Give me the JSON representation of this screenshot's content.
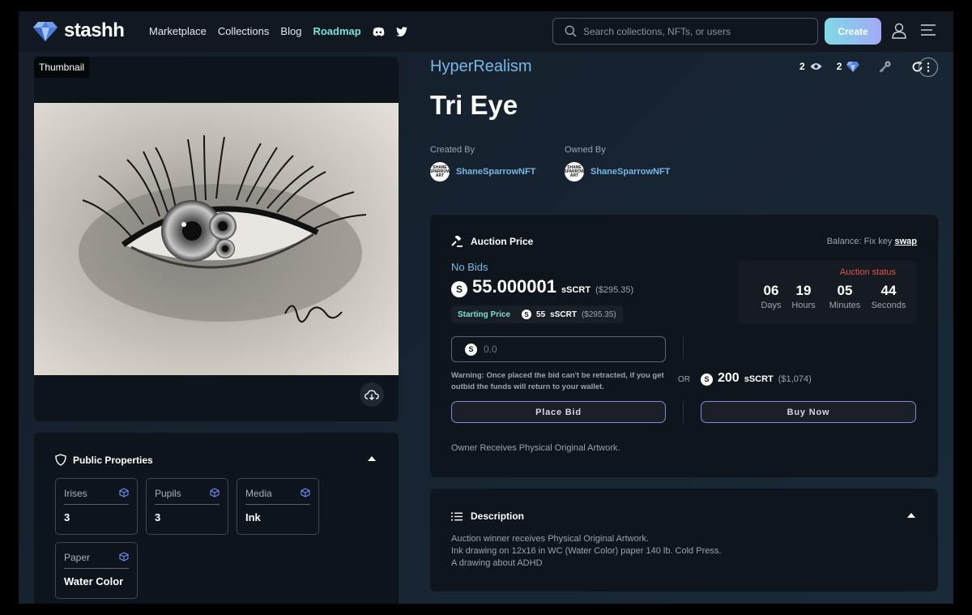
{
  "header": {
    "brand": "stashh",
    "nav": [
      "Marketplace",
      "Collections",
      "Blog",
      "Roadmap"
    ],
    "search_placeholder": "Search collections, NFTs, or users",
    "create_label": "Create"
  },
  "media": {
    "thumbnail_label": "Thumbnail"
  },
  "properties": {
    "title": "Public Properties",
    "items": [
      {
        "name": "Irises",
        "value": "3"
      },
      {
        "name": "Pupils",
        "value": "3"
      },
      {
        "name": "Media",
        "value": "Ink"
      },
      {
        "name": "Paper",
        "value": "Water Color"
      }
    ]
  },
  "nft": {
    "collection": "HyperRealism",
    "title": "Tri Eye",
    "views": "2",
    "likes": "2",
    "created_by_label": "Created By",
    "owned_by_label": "Owned By",
    "creator": "ShaneSparrowNFT",
    "owner": "ShaneSparrowNFT",
    "avatar_text": "SHANE SPARROW ART"
  },
  "auction": {
    "heading": "Auction Price",
    "balance_label": "Balance:",
    "balance_value": "Fix key",
    "swap_label": "swap",
    "no_bids": "No Bids",
    "price": "55.000001",
    "unit": "sSCRT",
    "price_usd": "($295.35)",
    "starting_label": "Starting Price",
    "starting_price": "55",
    "starting_usd": "($295.35)",
    "status_label": "Auction status",
    "countdown": [
      {
        "value": "06",
        "label": "Days"
      },
      {
        "value": "19",
        "label": "Hours"
      },
      {
        "value": "05",
        "label": "Minutes"
      },
      {
        "value": "44",
        "label": "Seconds"
      }
    ],
    "bid_placeholder": "0.0",
    "warning": "Warning: Once placed the bid can't be retracted, if you get outbid the funds will return to your wallet.",
    "or_label": "OR",
    "buy_price": "200",
    "buy_usd": "($1,074)",
    "place_bid_label": "Place Bid",
    "buy_now_label": "Buy Now",
    "owner_note": "Owner Receives Physical Original Artwork."
  },
  "description": {
    "heading": "Description",
    "lines": [
      "Auction winner receives Physical Original Artwork.",
      "Ink drawing on 12x16 in WC (Water Color) paper 140 lb. Cold Press.",
      "A drawing about ADHD"
    ]
  },
  "colors": {
    "accent_teal": "#7ee0d6",
    "link_blue": "#77b9e4",
    "status_red": "#e0544f"
  }
}
